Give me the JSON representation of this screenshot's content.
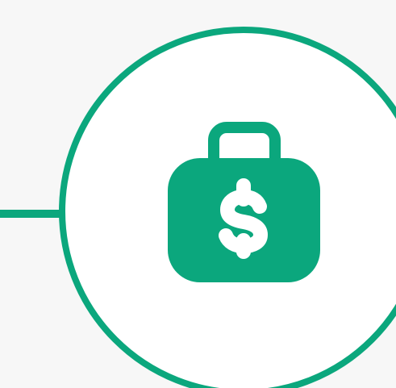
{
  "colors": {
    "background": "#f7f7f7",
    "accent": "#0ba77d",
    "circle_fill": "#ffffff",
    "icon_glyph": "#ffffff"
  },
  "diagram": {
    "node": {
      "icon": "money-bag-dollar-icon"
    },
    "connector": {
      "direction": "left"
    }
  }
}
